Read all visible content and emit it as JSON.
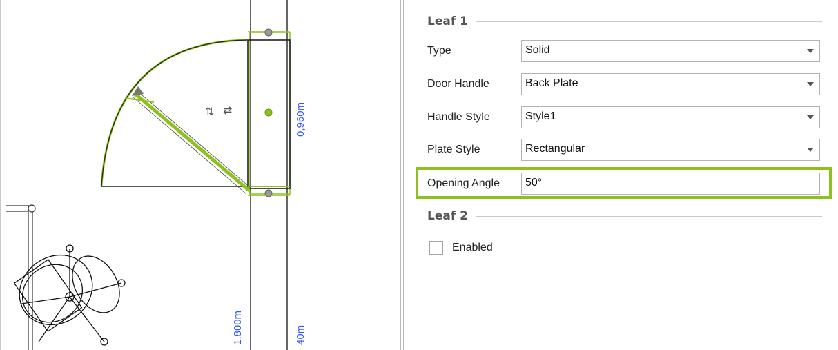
{
  "canvas": {
    "dimension_labels": {
      "door_width": "0,960m",
      "wall_length": "1,800m",
      "partial": "40m"
    },
    "flip_icon_name": "flip-arrows-icon",
    "swap_icon_name": "swap-arrows-icon",
    "accent_color": "#8cc21b"
  },
  "properties": {
    "leaf1": {
      "title": "Leaf 1",
      "rows": [
        {
          "label": "Type",
          "value": "Solid"
        },
        {
          "label": "Door Handle",
          "value": "Back Plate"
        },
        {
          "label": "Handle Style",
          "value": "Style1"
        },
        {
          "label": "Plate Style",
          "value": "Rectangular"
        }
      ],
      "opening_angle": {
        "label": "Opening Angle",
        "value": "50°"
      }
    },
    "leaf2": {
      "title": "Leaf 2",
      "enabled_label": "Enabled",
      "enabled": false
    }
  }
}
